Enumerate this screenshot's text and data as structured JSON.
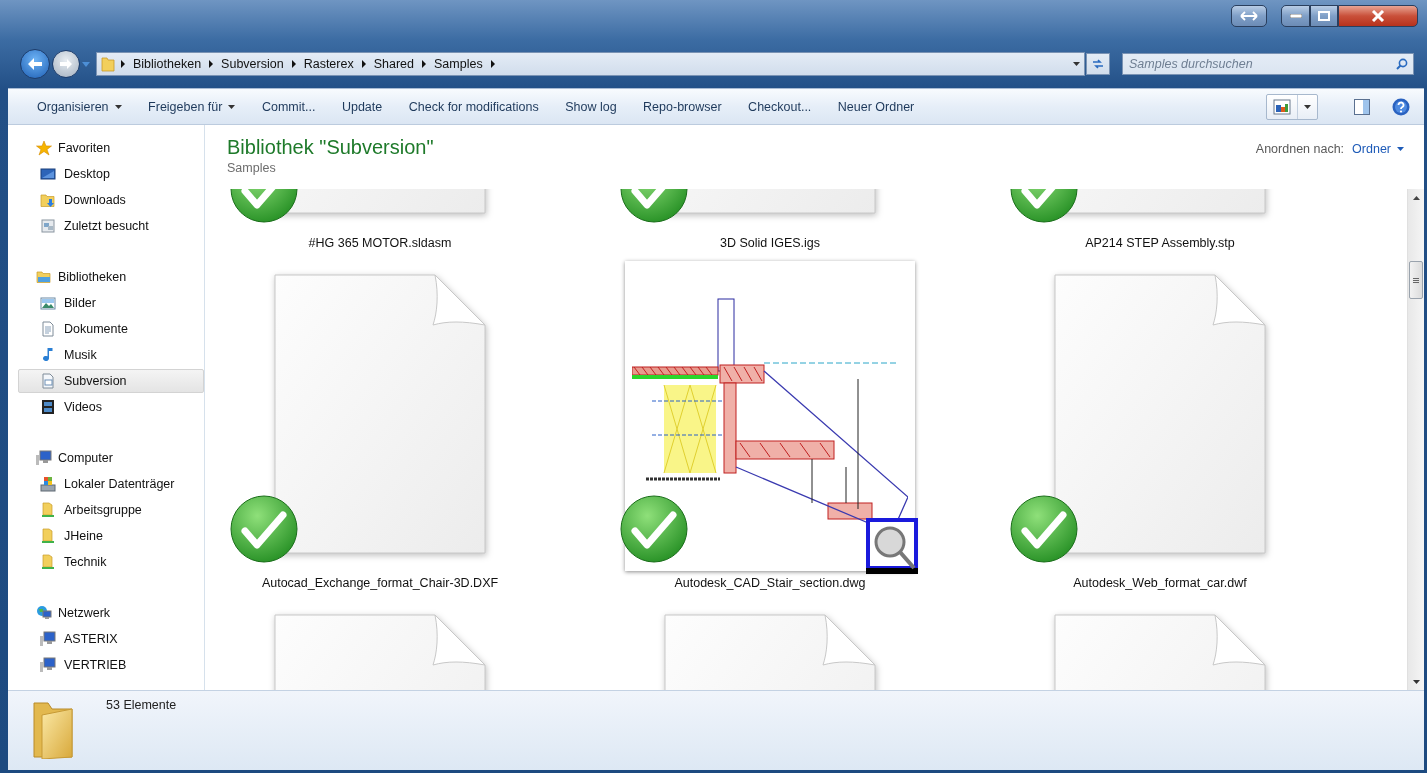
{
  "address_bar": {
    "breadcrumbs": [
      "Bibliotheken",
      "Subversion",
      "Rasterex",
      "Shared",
      "Samples"
    ]
  },
  "search": {
    "placeholder": "Samples durchsuchen"
  },
  "toolbar": [
    {
      "label": "Organisieren",
      "dropdown": true
    },
    {
      "label": "Freigeben für",
      "dropdown": true
    },
    {
      "label": "Commit...",
      "dropdown": false
    },
    {
      "label": "Update",
      "dropdown": false
    },
    {
      "label": "Check for modifications",
      "dropdown": false
    },
    {
      "label": "Show log",
      "dropdown": false
    },
    {
      "label": "Repo-browser",
      "dropdown": false
    },
    {
      "label": "Checkout...",
      "dropdown": false
    },
    {
      "label": "Neuer Ordner",
      "dropdown": false
    }
  ],
  "sidebar": {
    "groups": [
      {
        "heading": {
          "label": "Favoriten",
          "kind": "star"
        },
        "items": [
          {
            "label": "Desktop",
            "kind": "desktop",
            "selected": false
          },
          {
            "label": "Downloads",
            "kind": "downloads",
            "selected": false
          },
          {
            "label": "Zuletzt besucht",
            "kind": "recent",
            "selected": false
          }
        ]
      },
      {
        "heading": {
          "label": "Bibliotheken",
          "kind": "library"
        },
        "items": [
          {
            "label": "Bilder",
            "kind": "pictures",
            "selected": false
          },
          {
            "label": "Dokumente",
            "kind": "documents",
            "selected": false
          },
          {
            "label": "Musik",
            "kind": "music",
            "selected": false
          },
          {
            "label": "Subversion",
            "kind": "subversion",
            "selected": true
          },
          {
            "label": "Videos",
            "kind": "videos",
            "selected": false
          }
        ]
      },
      {
        "heading": {
          "label": "Computer",
          "kind": "computer"
        },
        "items": [
          {
            "label": "Lokaler Datenträger",
            "kind": "drive",
            "selected": false
          },
          {
            "label": "Arbeitsgruppe",
            "kind": "share",
            "selected": false
          },
          {
            "label": "JHeine",
            "kind": "share",
            "selected": false
          },
          {
            "label": "Technik",
            "kind": "share",
            "selected": false
          }
        ]
      },
      {
        "heading": {
          "label": "Netzwerk",
          "kind": "network"
        },
        "items": [
          {
            "label": "ASTERIX",
            "kind": "pc",
            "selected": false
          },
          {
            "label": "VERTRIEB",
            "kind": "pc",
            "selected": false
          }
        ]
      }
    ]
  },
  "library": {
    "title": "Bibliothek \"Subversion\"",
    "subtitle": "Samples",
    "arrange_label": "Anordnen nach:",
    "arrange_value": "Ordner"
  },
  "files": [
    {
      "name": "#HG 365 MOTOR.sldasm",
      "kind": "document",
      "versioned": true
    },
    {
      "name": "3D Solid IGES.igs",
      "kind": "document",
      "versioned": true
    },
    {
      "name": "AP214 STEP Assembly.stp",
      "kind": "document",
      "versioned": true
    },
    {
      "name": "Autocad_Exchange_format_Chair-3D.DXF",
      "kind": "document",
      "versioned": true
    },
    {
      "name": "Autodesk_CAD_Stair_section.dwg",
      "kind": "cad",
      "versioned": true
    },
    {
      "name": "Autodesk_Web_format_car.dwf",
      "kind": "document",
      "versioned": true
    },
    {
      "kind": "document"
    },
    {
      "kind": "document"
    },
    {
      "kind": "document"
    }
  ],
  "status_bar": {
    "count": "53 Elemente"
  }
}
